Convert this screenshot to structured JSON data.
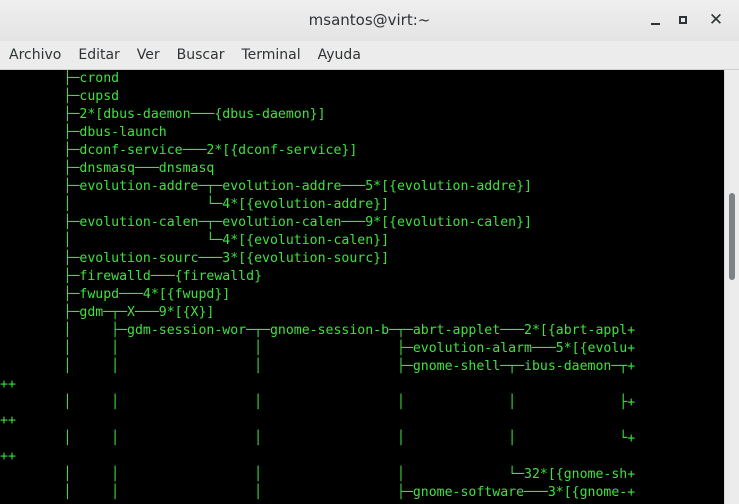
{
  "window": {
    "title": "msantos@virt:~"
  },
  "menu": [
    "Archivo",
    "Editar",
    "Ver",
    "Buscar",
    "Terminal",
    "Ayuda"
  ],
  "terminal": {
    "lines": [
      "        ├─crond",
      "        ├─cupsd",
      "        ├─2*[dbus-daemon───{dbus-daemon}]",
      "        ├─dbus-launch",
      "        ├─dconf-service───2*[{dconf-service}]",
      "        ├─dnsmasq───dnsmasq",
      "        ├─evolution-addre─┬─evolution-addre───5*[{evolution-addre}]",
      "        │                 └─4*[{evolution-addre}]",
      "        ├─evolution-calen─┬─evolution-calen───9*[{evolution-calen}]",
      "        │                 └─4*[{evolution-calen}]",
      "        ├─evolution-sourc───3*[{evolution-sourc}]",
      "        ├─firewalld───{firewalld}",
      "        ├─fwupd───4*[{fwupd}]",
      "        ├─gdm─┬─X───9*[{X}]",
      "        │     ├─gdm-session-wor─┬─gnome-session-b─┬─abrt-applet───2*[{abrt-appl+",
      "        │     │                 │                 ├─evolution-alarm───5*[{evolu+",
      "        │     │                 │                 ├─gnome-shell─┬─ibus-daemon─┬+",
      "++",
      "        │     │                 │                 │             │             ├+",
      "++",
      "        │     │                 │                 │             │             └+",
      "++",
      "        │     │                 │                 │             └─32*[{gnome-sh+",
      "        │     │                 │                 ├─gnome-software───3*[{gnome-+"
    ]
  },
  "scrollbar": {
    "position_fraction": 0.33
  }
}
